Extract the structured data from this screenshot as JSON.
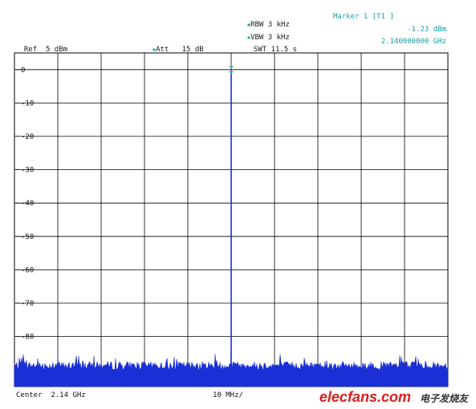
{
  "header": {
    "ref_label": "Ref",
    "ref_value": "5 dBm",
    "att_label": "Att",
    "att_value": "15 dB",
    "rbw_label": "RBW",
    "rbw_value": "3 kHz",
    "vbw_label": "VBW",
    "vbw_value": "3 kHz",
    "swt_label": "SWT",
    "swt_value": "11.5 s",
    "marker_title": "Marker 1 [T1 ]",
    "marker_level": "-1.23 dBm",
    "marker_freq": "2.140000000 GHz"
  },
  "footer": {
    "center": "Center  2.14 GHz",
    "span_div": "10 MHz/"
  },
  "watermark": {
    "brand": "elecfans.com",
    "cn": "电子发烧友"
  },
  "colors": {
    "trace": "#1a2fd6",
    "marker": "#1a9c9c",
    "grid": "#000000"
  },
  "chart_data": {
    "type": "line",
    "title": "",
    "xlabel": "",
    "ylabel": "",
    "y_unit": "dBm",
    "ylim": [
      -95,
      5
    ],
    "yticks": [
      0,
      -10,
      -20,
      -30,
      -40,
      -50,
      -60,
      -70,
      -80
    ],
    "ytick_labels": [
      "0",
      "-10",
      "-20",
      "-30",
      "-40",
      "-50",
      "-60",
      "-70",
      "-80"
    ],
    "x_center_ghz": 2.14,
    "x_span_per_div_mhz": 10,
    "x_divisions": 10,
    "grid": true,
    "series": [
      {
        "values_note": "",
        "noise_floor_dbm": -90,
        "peak": {
          "x_ghz": 2.14,
          "y_dbm": -1.23
        },
        "spurs": [
          {
            "x_ghz": 2.14,
            "y_dbm": -78
          },
          {
            "x_ghz": 2.1,
            "y_dbm": -85
          }
        ]
      }
    ],
    "markers": [
      {
        "name": "1",
        "x_ghz": 2.14,
        "y_dbm": -1.23
      }
    ]
  }
}
